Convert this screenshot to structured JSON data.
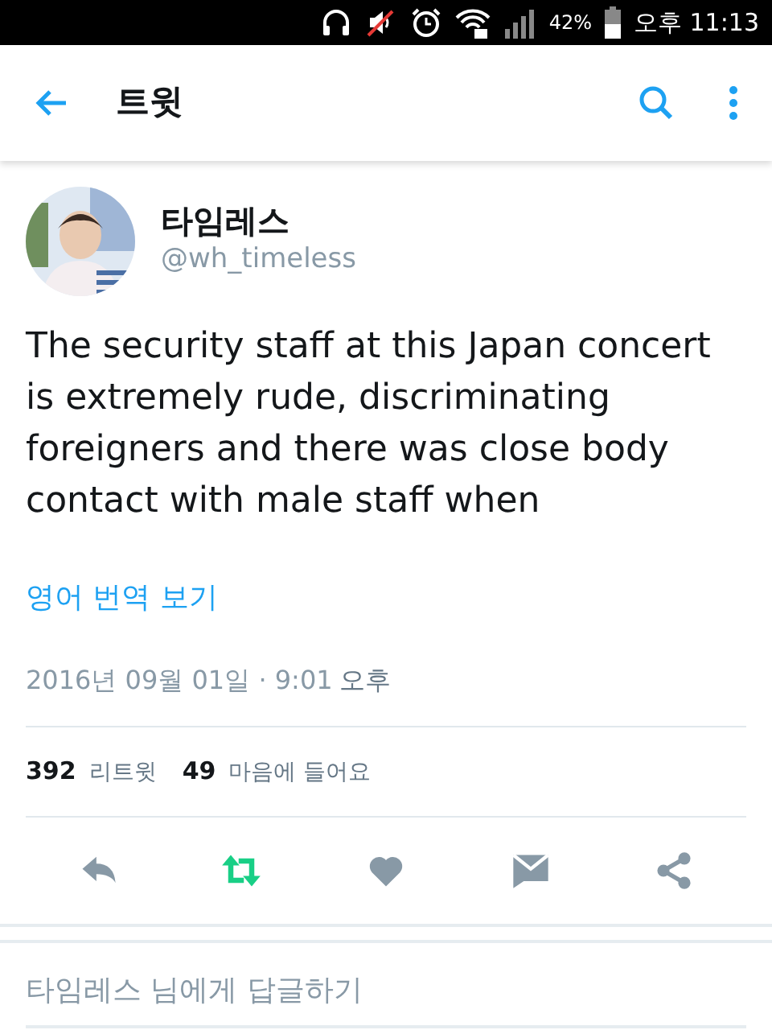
{
  "status_bar": {
    "battery_text": "42%",
    "time": "오후 11:13"
  },
  "toolbar": {
    "title": "트윗"
  },
  "tweet": {
    "author_name": "타임레스",
    "handle": "@wh_timeless",
    "text": "The security staff at this Japan concert is extremely rude, discriminating foreigners and there was close body contact with male staff when",
    "translate_link": "영어 번역 보기",
    "date": "2016년 09월 01일 · 9:01",
    "ampm": "오후"
  },
  "stats": [
    {
      "count": "392",
      "label": "리트윗"
    },
    {
      "count": "49",
      "label": "마음에 들어요"
    }
  ],
  "actions": [
    {
      "kind": "reply",
      "active": false
    },
    {
      "kind": "retweet",
      "active": true
    },
    {
      "kind": "like",
      "active": false
    },
    {
      "kind": "message",
      "active": false
    },
    {
      "kind": "share",
      "active": false
    }
  ],
  "reply_field": {
    "placeholder": "타임레스 님에게 답글하기"
  }
}
